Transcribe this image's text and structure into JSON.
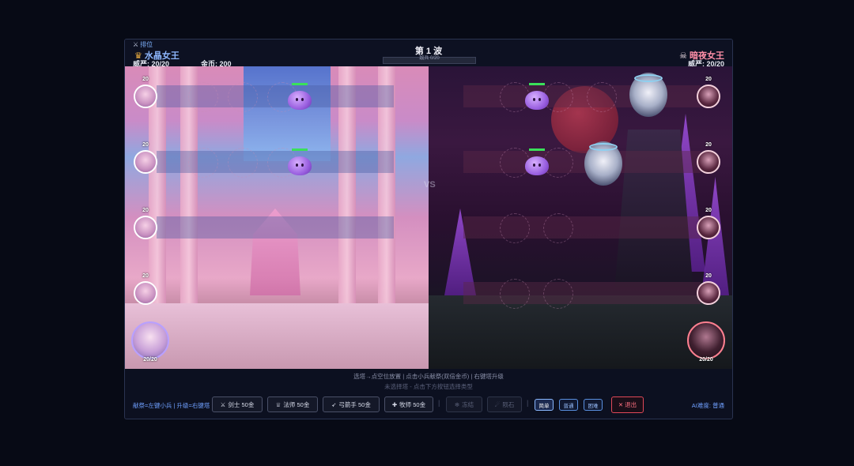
{
  "header": {
    "rank_label": "排位",
    "player_left": {
      "name": "水晶女王",
      "prestige": "威严: 20/20",
      "gold": "金币: 200"
    },
    "player_right": {
      "name": "暗夜女王",
      "prestige": "威严: 20/20"
    },
    "wave": "第 1 波",
    "wave_progress": "敌兵 0/20"
  },
  "field": {
    "vs": "VS",
    "left_heroes": [
      "20",
      "20",
      "20",
      "20"
    ],
    "right_heroes": [
      "20",
      "20",
      "20",
      "20"
    ],
    "left_queen_hp": "20/20",
    "right_queen_hp": "20/20"
  },
  "help": {
    "line1": "选塔→点空位放置 | 点击小兵献祭(双倍金币) | 右键塔升级",
    "line2": "未选择塔 - 点击下方按钮选择类型"
  },
  "controls": {
    "hint": "献祭=左键小兵 | 升级=右键塔",
    "towers": [
      {
        "label": "剑士 50金",
        "icon": "sword-icon"
      },
      {
        "label": "法师 50金",
        "icon": "mage-icon"
      },
      {
        "label": "弓箭手 50金",
        "icon": "bow-icon"
      },
      {
        "label": "牧师 50金",
        "icon": "cross-icon"
      }
    ],
    "skills": [
      {
        "label": "冻结",
        "icon": "snowflake-icon"
      },
      {
        "label": "陨石",
        "icon": "meteor-icon"
      }
    ],
    "difficulties": [
      "简单",
      "普通",
      "困难"
    ],
    "active_difficulty": "简单",
    "exit_label": "✕ 退出",
    "ai_difficulty": "AI难度: 普通"
  },
  "colors": {
    "left_accent": "#8fb8ff",
    "right_accent": "#ff8fa8",
    "exit": "#e04858"
  }
}
